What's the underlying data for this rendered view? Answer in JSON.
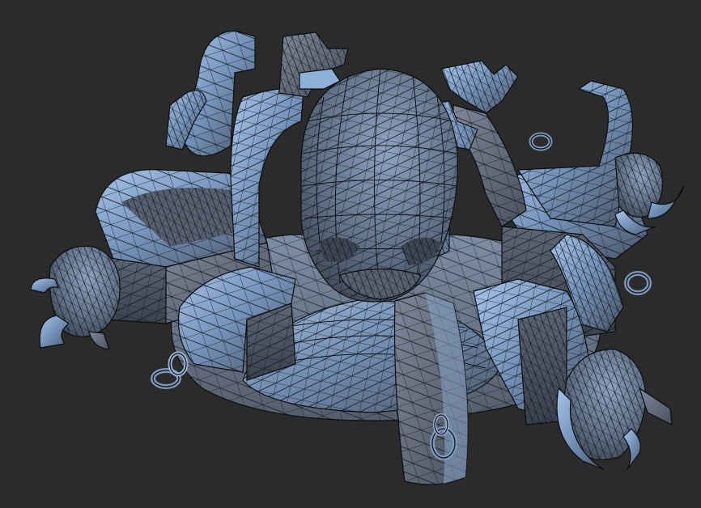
{
  "viewport": {
    "background": "#2b2b2b",
    "display_mode": "wireframe-on-shaded"
  },
  "model": {
    "subject": "skull-altar-with-horns-and-chains",
    "base_color": "#6f86a3",
    "highlight_color": "#a9c3e6",
    "shadow_color": "#3f4652",
    "wire_color": "#0f141a"
  }
}
